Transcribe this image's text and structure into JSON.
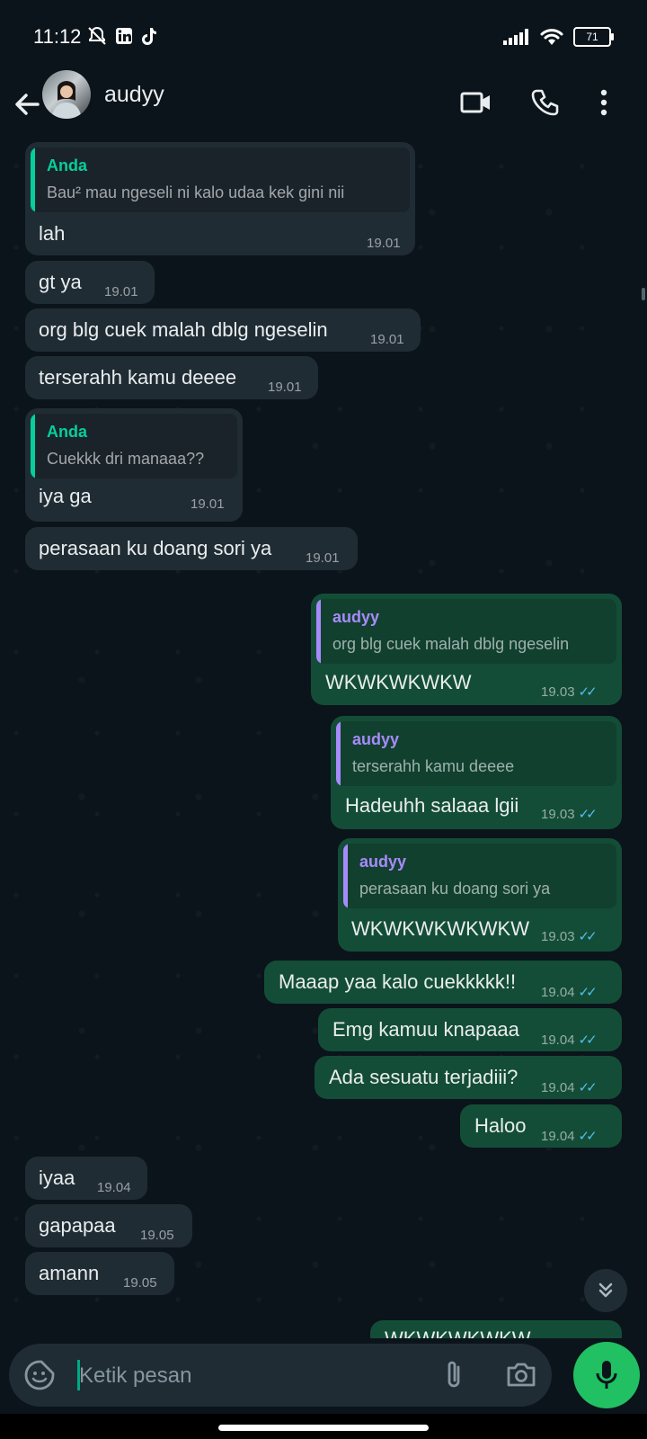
{
  "status_bar": {
    "time": "11:12",
    "battery": "71"
  },
  "app_bar": {
    "contact_name": "audyy"
  },
  "messages": [
    {
      "reply": {
        "author": "Anda",
        "text": "Bau² mau ngeseli ni kalo udaa kek gini nii"
      },
      "text": "lah",
      "time": "19.01"
    },
    {
      "text": "gt ya",
      "time": "19.01"
    },
    {
      "text": "org blg cuek malah dblg ngeselin",
      "time": "19.01"
    },
    {
      "text": "terserahh kamu deeee",
      "time": "19.01"
    },
    {
      "reply": {
        "author": "Anda",
        "text": "Cuekkk dri manaaa??"
      },
      "text": "iya ga",
      "time": "19.01"
    },
    {
      "text": "perasaan ku doang sori ya",
      "time": "19.01"
    },
    {
      "reply": {
        "author": "audyy",
        "text": "org blg cuek malah dblg ngeselin"
      },
      "text": "WKWKWKWKW",
      "time": "19.03"
    },
    {
      "reply": {
        "author": "audyy",
        "text": "terserahh kamu deeee"
      },
      "text": "Hadeuhh salaaa lgii",
      "time": "19.03"
    },
    {
      "reply": {
        "author": "audyy",
        "text": "perasaan ku doang sori ya"
      },
      "text": "WKWKWKWKWKW",
      "time": "19.03"
    },
    {
      "text": "Maaap yaa kalo cuekkkkk!!",
      "time": "19.04"
    },
    {
      "text": "Emg kamuu knapaaa",
      "time": "19.04"
    },
    {
      "text": "Ada sesuatu terjadiii?",
      "time": "19.04"
    },
    {
      "text": "Haloo",
      "time": "19.04"
    },
    {
      "text": "iyaa",
      "time": "19.04"
    },
    {
      "text": "gapapaa",
      "time": "19.05"
    },
    {
      "text": "amann",
      "time": "19.05"
    },
    {
      "text": "WKWKWKWKW"
    }
  ],
  "input": {
    "placeholder": "Ketik pesan"
  },
  "colors": {
    "incoming_bubble": "#202c33",
    "outgoing_bubble": "#144d37",
    "read_ticks": "#53bdeb",
    "mic_button": "#21c063",
    "quote_bar_self": "#06cf9c",
    "quote_bar_contact": "#a78bfa"
  },
  "icons": [
    "back-arrow-icon",
    "video-call-icon",
    "voice-call-icon",
    "more-vert-icon",
    "sticker-icon",
    "attach-icon",
    "camera-icon",
    "mic-icon",
    "double-chevron-down-icon"
  ]
}
